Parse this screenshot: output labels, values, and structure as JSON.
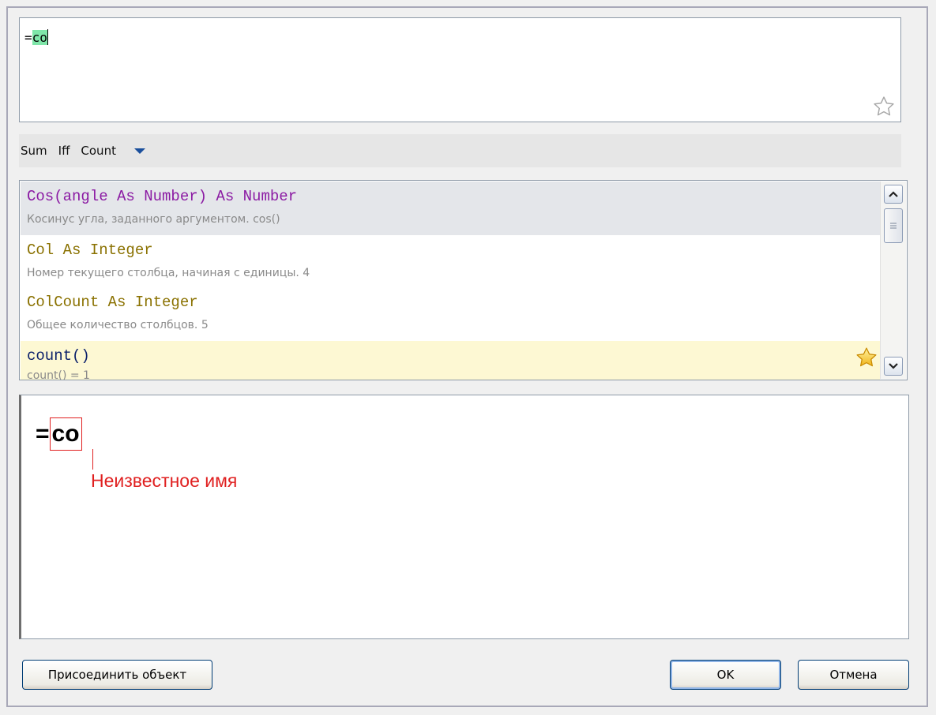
{
  "editor": {
    "prefix": "=",
    "highlighted": "co",
    "favorite_icon": "star-outline-icon"
  },
  "quickbar": {
    "items": [
      "Sum",
      "Iff",
      "Count"
    ],
    "dropdown_icon": "triangle-down-icon"
  },
  "list": {
    "items": [
      {
        "signature": "Cos(angle As Number) As Number",
        "description": "Косинус угла, заданного аргументом. cos()"
      },
      {
        "signature": "Col As Integer",
        "description": "Номер текущего столбца, начиная с единицы. 4"
      },
      {
        "signature": "ColCount As Integer",
        "description": "Общее количество столбцов. 5"
      },
      {
        "signature": "count()",
        "description": "count() = 1"
      }
    ]
  },
  "preview": {
    "eq": "=",
    "token": "co",
    "error": "Неизвестное имя"
  },
  "buttons": {
    "attach": "Присоединить объект",
    "ok": "OK",
    "cancel": "Отмена"
  },
  "colors": {
    "highlight": "#7fe6a9",
    "error": "#e02020",
    "selected_row": "#e4e6ea",
    "favorite_row": "#fdf8d3"
  }
}
